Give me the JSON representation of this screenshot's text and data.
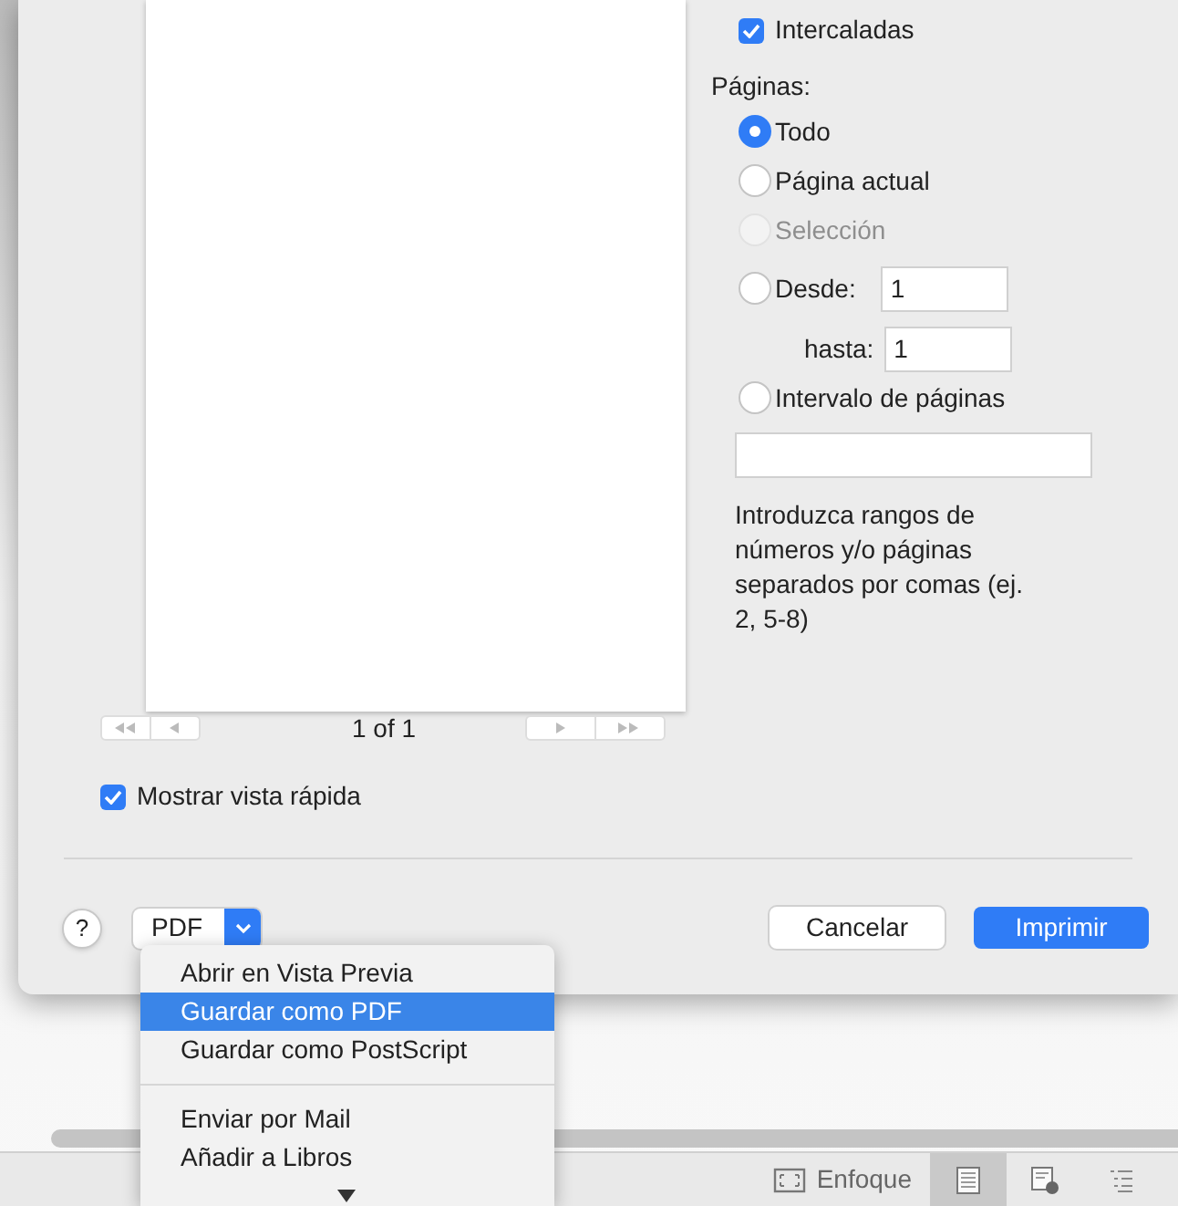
{
  "preview": {
    "page_indicator": "1 of 1"
  },
  "collate": {
    "label": "Intercaladas",
    "checked": true
  },
  "pages": {
    "label": "Páginas:",
    "options": [
      {
        "kind": "plain",
        "label": "Todo",
        "selected": true,
        "disabled": false
      },
      {
        "kind": "plain",
        "label": "Página actual",
        "selected": false,
        "disabled": false
      },
      {
        "kind": "plain",
        "label": "Selección",
        "selected": false,
        "disabled": true
      },
      {
        "kind": "from",
        "label": "Desde:",
        "value": "1",
        "selected": false,
        "disabled": false
      },
      {
        "kind": "to",
        "label": "hasta:",
        "value": "1"
      },
      {
        "kind": "interval",
        "label": "Intervalo de páginas",
        "selected": false,
        "disabled": false
      }
    ],
    "hint": "Introduzca rangos de números y/o páginas separados por comas (ej. 2, 5-8)"
  },
  "quick_preview": {
    "label": "Mostrar vista rápida",
    "checked": true
  },
  "footer": {
    "help": "?",
    "pdf_button": "PDF",
    "cancel": "Cancelar",
    "print": "Imprimir"
  },
  "pdf_menu": {
    "items": [
      {
        "kind": "item",
        "label": "Abrir en Vista Previa",
        "selected": false
      },
      {
        "kind": "item",
        "label": "Guardar como PDF",
        "selected": true
      },
      {
        "kind": "item",
        "label": "Guardar como PostScript",
        "selected": false
      },
      {
        "kind": "separator"
      },
      {
        "kind": "item",
        "label": "Enviar por Mail",
        "selected": false
      },
      {
        "kind": "item",
        "label": "Añadir a Libros",
        "selected": false
      }
    ]
  },
  "toolbar": {
    "items": [
      {
        "kind": "focus",
        "label": "Enfoque",
        "selected": false
      },
      {
        "kind": "page-view",
        "selected": true
      },
      {
        "kind": "web-view",
        "selected": false
      },
      {
        "kind": "outline",
        "selected": false
      }
    ]
  }
}
